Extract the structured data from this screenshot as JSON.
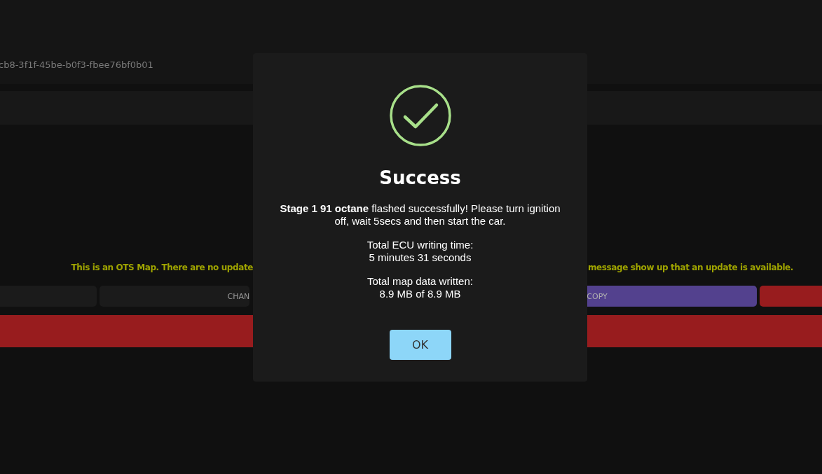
{
  "header": {
    "id_text": "cb8-3f1f-45be-b0f3-fbee76bf0b01"
  },
  "notice": {
    "left": "This is an OTS Map. There are no update",
    "right": "message show up that an update is available."
  },
  "buttons": [
    {
      "kind": "plain"
    },
    {
      "label": "CHAN",
      "kind": "plain"
    },
    {
      "label": "COPY",
      "kind": "purple"
    },
    {
      "kind": "red"
    }
  ],
  "dialog": {
    "title": "Success",
    "paragraphs": [
      "**Stage 1 91 octane** flashed successfully! Please turn ignition off, wait 5secs and then start the car.",
      "Total ECU writing time:\n5 minutes 31 seconds",
      "Total map data written:\n8.9 MB of 8.9 MB"
    ],
    "ok_button": "OK"
  }
}
